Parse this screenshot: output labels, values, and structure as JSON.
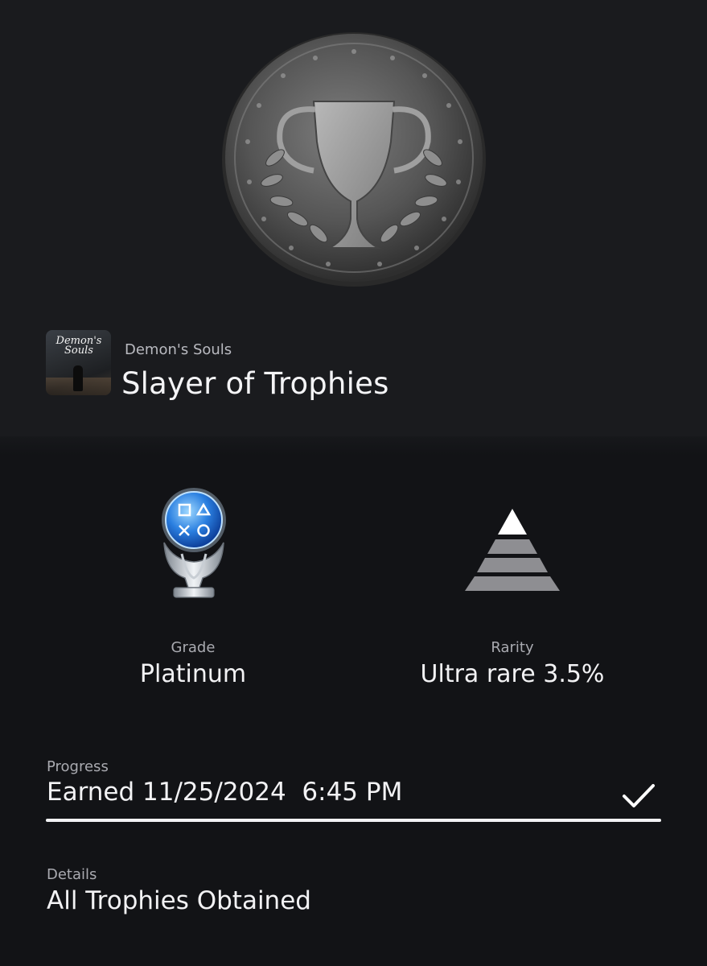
{
  "trophy": {
    "game_name": "Demon's Souls",
    "game_logo_text": "Demon's Souls",
    "title": "Slayer of Trophies",
    "image_icon": "silver-coin-trophy-icon"
  },
  "grade": {
    "label": "Grade",
    "value": "Platinum",
    "icon": "platinum-trophy-icon"
  },
  "rarity": {
    "label": "Rarity",
    "value": "Ultra rare 3.5%",
    "icon": "rarity-pyramid-icon"
  },
  "progress": {
    "label": "Progress",
    "value": "Earned 11/25/2024  6:45 PM",
    "fraction": 1.0,
    "icon": "checkmark-icon"
  },
  "details": {
    "label": "Details",
    "value": "All Trophies Obtained"
  }
}
